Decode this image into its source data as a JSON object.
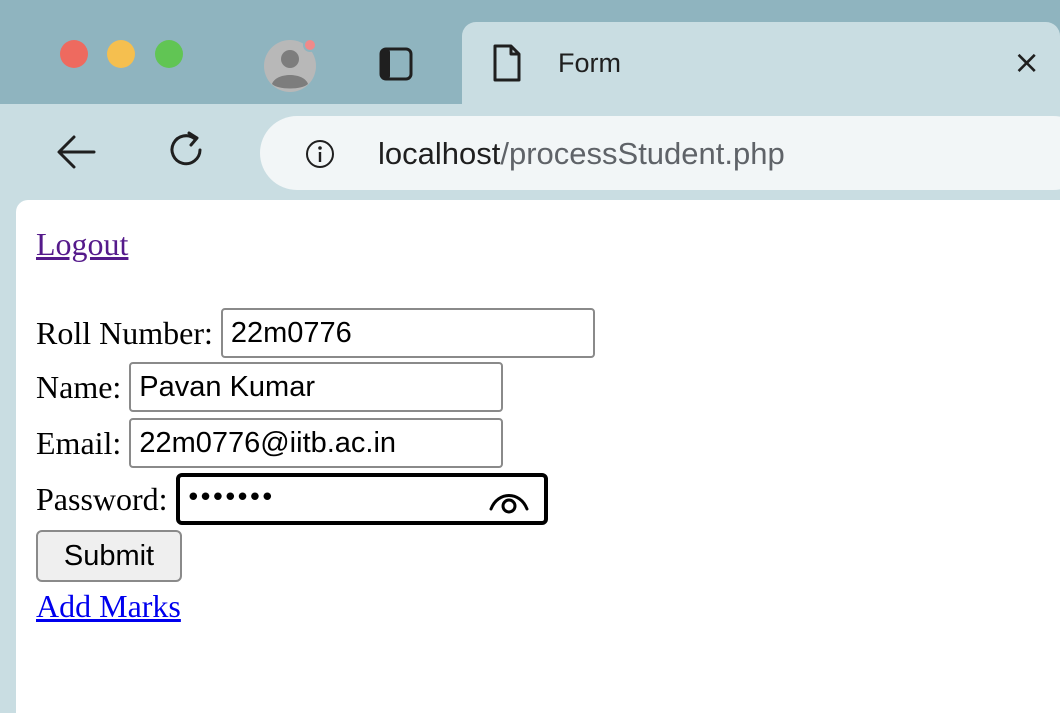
{
  "browser": {
    "tab": {
      "title": "Form",
      "close_glyph": "×"
    },
    "address": {
      "host": "localhost",
      "path": "/processStudent.php"
    },
    "icons": {
      "back": "arrow-left-icon",
      "reload": "reload-icon",
      "info": "info-icon",
      "tab_overview": "tab-overview-icon",
      "document": "document-icon",
      "profile": "profile-avatar-icon"
    },
    "colors": {
      "close": "#ee6a5f",
      "minimize": "#f5bf4f",
      "zoom": "#61c554",
      "frame": "#8fb4bf",
      "toolbar": "#c9dde2"
    }
  },
  "page": {
    "logout_link": "Logout",
    "form": {
      "roll": {
        "label": "Roll Number:",
        "value": "22m0776"
      },
      "name": {
        "label": "Name:",
        "value": "Pavan Kumar"
      },
      "email": {
        "label": "Email:",
        "value": "22m0776@iitb.ac.in"
      },
      "password": {
        "label": "Password:",
        "masked": "•••••••"
      },
      "submit_label": "Submit"
    },
    "add_marks_link": "Add Marks",
    "link_colors": {
      "visited": "#551a8b",
      "unvisited": "#0000ee"
    }
  }
}
